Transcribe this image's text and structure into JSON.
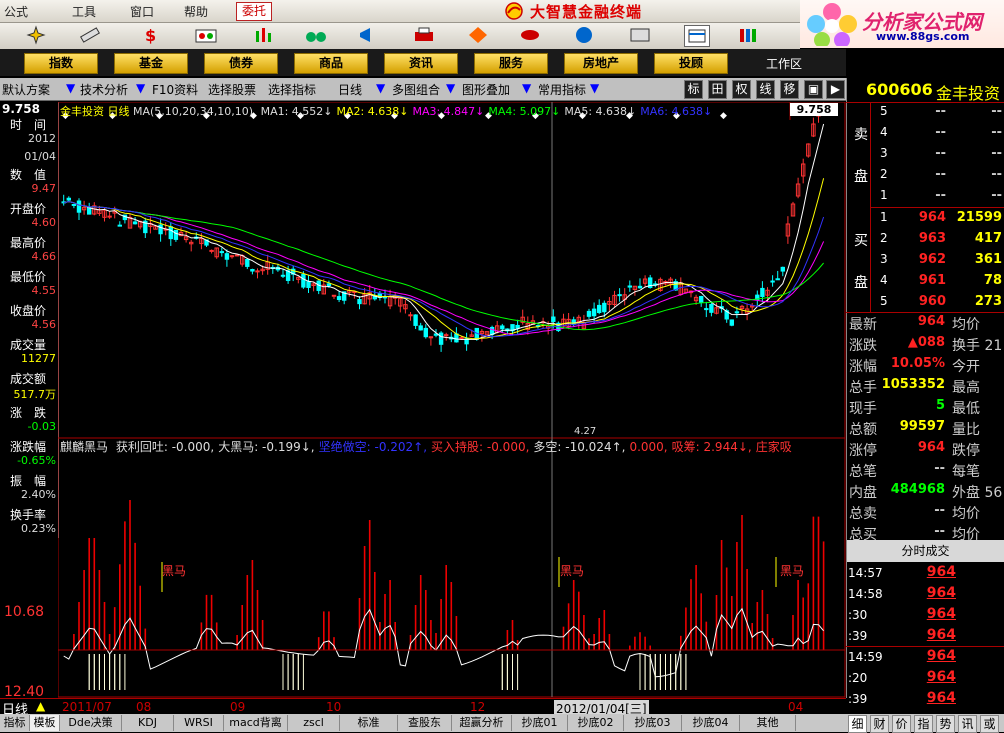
{
  "menu": {
    "items": [
      "公式",
      "工具",
      "窗口",
      "帮助"
    ],
    "entrust": "委托"
  },
  "app_title": "大智慧金融终端",
  "brand": {
    "name": "分析家公式网",
    "url": "www.88gs.com"
  },
  "categories": [
    "指数",
    "基金",
    "债券",
    "商品",
    "资讯",
    "服务",
    "房地产",
    "投顾"
  ],
  "work_area": "工作区",
  "funcbar": {
    "items": [
      "默认方案",
      "技术分析",
      "F10资料",
      "选择股票",
      "选择指标",
      "日线",
      "多图组合",
      "图形叠加",
      "常用指标"
    ],
    "right_buttons": [
      "标",
      "田",
      "权",
      "线",
      "移"
    ]
  },
  "left_panel": {
    "top_value": "9.758",
    "rows": [
      {
        "label": "时　间",
        "value": "2012",
        "color": "#ddd"
      },
      {
        "label": "",
        "value": "01/04",
        "color": "#ddd"
      },
      {
        "label": "数　值",
        "value": "9.47",
        "color": "#f44"
      },
      {
        "label": "开盘价",
        "value": "4.60",
        "color": "#f44"
      },
      {
        "label": "最高价",
        "value": "4.66",
        "color": "#f44"
      },
      {
        "label": "最低价",
        "value": "4.55",
        "color": "#f44"
      },
      {
        "label": "收盘价",
        "value": "4.56",
        "color": "#f44"
      },
      {
        "label": "成交量",
        "value": "11277",
        "color": "#ff0"
      },
      {
        "label": "成交额",
        "value": "517.7万",
        "color": "#ff0"
      },
      {
        "label": "涨　跌",
        "value": "-0.03",
        "color": "#0f0"
      },
      {
        "label": "涨跌幅",
        "value": "-0.65%",
        "color": "#0f0"
      },
      {
        "label": "振　幅",
        "value": "2.40%",
        "color": "#ddd"
      },
      {
        "label": "换手率",
        "value": "0.23%",
        "color": "#ddd"
      }
    ]
  },
  "kline_header": {
    "stock": "金丰投资",
    "period": "日线",
    "ma": "MA(5,10,20,34,10,10)",
    "items": [
      {
        "text": "MA1: 4.552↓",
        "color": "#ddd"
      },
      {
        "text": "MA2: 4.638↓",
        "color": "#ff0"
      },
      {
        "text": "MA3: 4.847↓",
        "color": "#f0f"
      },
      {
        "text": "MA4: 5.097↓",
        "color": "#0f0"
      },
      {
        "text": "MA5: 4.638↓",
        "color": "#ddd"
      },
      {
        "text": "MA6: 4.638↓",
        "color": "#33f"
      }
    ],
    "top_price": "9.758",
    "low_price": "4.27"
  },
  "indicator_header": {
    "name": "麒麟黑马",
    "items": [
      {
        "text": "获利回吐: -0.000,",
        "color": "#ddd"
      },
      {
        "text": "大黑马: -0.199↓,",
        "color": "#ddd"
      },
      {
        "text": "坚绝做空: -0.202↑,",
        "color": "#33f"
      },
      {
        "text": "买入持股: -0.000,",
        "color": "#f33"
      },
      {
        "text": "多空: -10.024↑,",
        "color": "#ddd"
      },
      {
        "text": "0.000,",
        "color": "#f33"
      },
      {
        "text": "吸筹: 2.944↓,",
        "color": "#f33"
      },
      {
        "text": "庄家吸",
        "color": "#f33"
      }
    ],
    "labels": [
      "黑马",
      "黑马",
      "黑马"
    ],
    "axis": [
      "10.68",
      "12.40"
    ]
  },
  "stock": {
    "code": "600606",
    "name": "金丰投资"
  },
  "orderbook": {
    "sell_label": [
      "卖",
      "盘"
    ],
    "buy_label": [
      "买",
      "盘"
    ],
    "sells": [
      {
        "level": "5",
        "price": "--",
        "vol": "--"
      },
      {
        "level": "4",
        "price": "--",
        "vol": "--"
      },
      {
        "level": "3",
        "price": "--",
        "vol": "--"
      },
      {
        "level": "2",
        "price": "--",
        "vol": "--"
      },
      {
        "level": "1",
        "price": "--",
        "vol": "--"
      }
    ],
    "buys": [
      {
        "level": "1",
        "price": "964",
        "vol": "21599"
      },
      {
        "level": "2",
        "price": "963",
        "vol": "417"
      },
      {
        "level": "3",
        "price": "962",
        "vol": "361"
      },
      {
        "level": "4",
        "price": "961",
        "vol": "78"
      },
      {
        "level": "5",
        "price": "960",
        "vol": "273"
      }
    ]
  },
  "stats": [
    {
      "k": "最新",
      "v": "964",
      "vc": "#f22",
      "k2": "均价"
    },
    {
      "k": "涨跌",
      "v": "▲088",
      "vc": "#f22",
      "k2": "换手 21"
    },
    {
      "k": "涨幅",
      "v": "10.05%",
      "vc": "#f22",
      "k2": "今开"
    },
    {
      "k": "总手",
      "v": "1053352",
      "vc": "#ff0",
      "k2": "最高"
    },
    {
      "k": "现手",
      "v": "5",
      "vc": "#0f0",
      "k2": "最低"
    },
    {
      "k": "总额",
      "v": "99597",
      "vc": "#ff0",
      "k2": "量比"
    },
    {
      "k": "涨停",
      "v": "964",
      "vc": "#f22",
      "k2": "跌停"
    },
    {
      "k": "总笔",
      "v": "--",
      "vc": "#ccc",
      "k2": "每笔"
    },
    {
      "k": "内盘",
      "v": "484968",
      "vc": "#0f0",
      "k2": "外盘 56"
    },
    {
      "k": "总卖",
      "v": "--",
      "vc": "#ccc",
      "k2": "均价"
    },
    {
      "k": "总买",
      "v": "--",
      "vc": "#ccc",
      "k2": "均价"
    }
  ],
  "trades": {
    "title": "分时成交",
    "rows": [
      {
        "t": "14:57",
        "p": "964"
      },
      {
        "t": "14:58",
        "p": "964"
      },
      {
        "t": ":30",
        "p": "964"
      },
      {
        "t": ":39",
        "p": "964"
      },
      {
        "t": "14:59",
        "p": "964"
      },
      {
        "t": ":20",
        "p": "964"
      },
      {
        "t": ":39",
        "p": "964"
      }
    ]
  },
  "datebar": {
    "period": "日线",
    "labels": [
      "2011/07",
      "08",
      "09",
      "10",
      "12",
      "2012/01/04[三]",
      "04"
    ]
  },
  "tabs": [
    "指标",
    "模板",
    "Dde决策",
    "KDJ",
    "WRSI",
    "macd背离",
    "zscl",
    "标准",
    "查股东",
    "超赢分析",
    "抄底01",
    "抄底02",
    "抄底03",
    "抄底04",
    "其他"
  ],
  "right_tabs": [
    "细",
    "财",
    "价",
    "指",
    "势",
    "讯",
    "或"
  ],
  "colors": {
    "up": "#ff3333",
    "down": "#00ffff",
    "ma1": "#ffffff",
    "ma2": "#ffff00",
    "ma3": "#ff00ff",
    "ma4": "#00ff00",
    "ma6": "#3333ff"
  }
}
